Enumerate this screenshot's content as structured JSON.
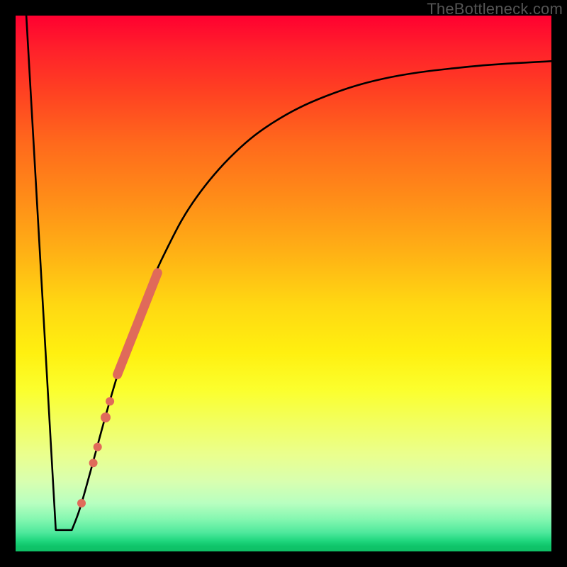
{
  "watermark": "TheBottleneck.com",
  "chart_data": {
    "type": "line",
    "title": "",
    "xlabel": "",
    "ylabel": "",
    "xlim": [
      0,
      100
    ],
    "ylim": [
      0,
      100
    ],
    "gradient_stops": [
      {
        "pos": 0,
        "color": "#ff0030"
      },
      {
        "pos": 24,
        "color": "#ff6a1c"
      },
      {
        "pos": 54,
        "color": "#ffd812"
      },
      {
        "pos": 76,
        "color": "#f2ff60"
      },
      {
        "pos": 96,
        "color": "#4ee89c"
      },
      {
        "pos": 100,
        "color": "#0fbf66"
      }
    ],
    "series": [
      {
        "name": "left-drop",
        "type": "line",
        "points": [
          {
            "x": 2.0,
            "y": 100.0
          },
          {
            "x": 7.5,
            "y": 4.0
          }
        ]
      },
      {
        "name": "valley-floor",
        "type": "line",
        "points": [
          {
            "x": 7.5,
            "y": 4.0
          },
          {
            "x": 10.5,
            "y": 4.0
          }
        ]
      },
      {
        "name": "rising-asymptote",
        "type": "line",
        "points": [
          {
            "x": 10.5,
            "y": 4.0
          },
          {
            "x": 12.0,
            "y": 8.0
          },
          {
            "x": 14.0,
            "y": 15.0
          },
          {
            "x": 17.0,
            "y": 26.0
          },
          {
            "x": 20.0,
            "y": 36.0
          },
          {
            "x": 24.0,
            "y": 47.0
          },
          {
            "x": 28.0,
            "y": 56.0
          },
          {
            "x": 33.0,
            "y": 65.0
          },
          {
            "x": 40.0,
            "y": 73.5
          },
          {
            "x": 48.0,
            "y": 80.0
          },
          {
            "x": 58.0,
            "y": 85.0
          },
          {
            "x": 70.0,
            "y": 88.5
          },
          {
            "x": 85.0,
            "y": 90.5
          },
          {
            "x": 100.0,
            "y": 91.5
          }
        ]
      },
      {
        "name": "thick-salmon-segment",
        "type": "line",
        "stroke": "#e06a5a",
        "stroke_width": 13,
        "points": [
          {
            "x": 19.0,
            "y": 33.0
          },
          {
            "x": 26.5,
            "y": 52.0
          }
        ]
      }
    ],
    "markers": [
      {
        "x": 12.3,
        "y": 9.0,
        "r": 6,
        "color": "#e06a5a"
      },
      {
        "x": 14.5,
        "y": 16.5,
        "r": 6,
        "color": "#e06a5a"
      },
      {
        "x": 15.3,
        "y": 19.5,
        "r": 6,
        "color": "#e06a5a"
      },
      {
        "x": 16.8,
        "y": 25.0,
        "r": 7,
        "color": "#e06a5a"
      },
      {
        "x": 17.6,
        "y": 28.0,
        "r": 6,
        "color": "#e06a5a"
      }
    ]
  }
}
